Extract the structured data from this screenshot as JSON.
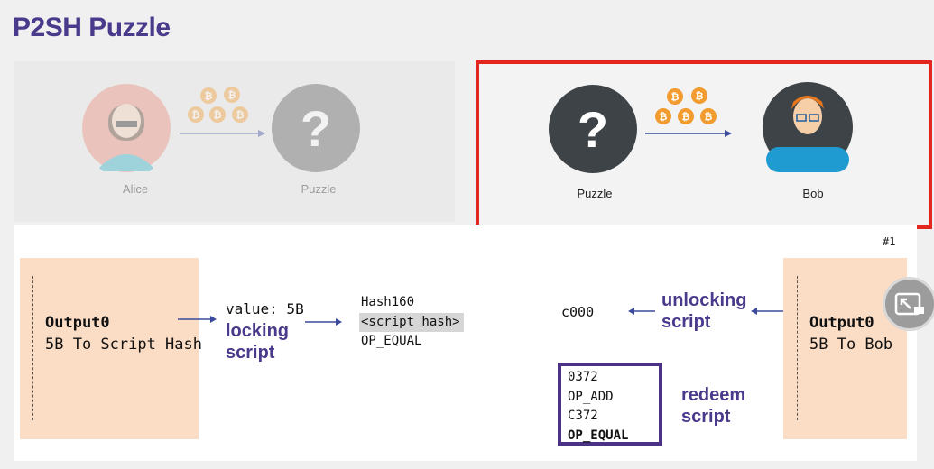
{
  "title": "P2SH Puzzle",
  "top_left": {
    "sender_label": "Alice",
    "receiver_label": "Puzzle"
  },
  "top_right": {
    "sender_label": "Puzzle",
    "receiver_label": "Bob"
  },
  "page_marker": "#1",
  "left_output": {
    "title": "Output0",
    "subtitle": "5B To Script Hash"
  },
  "value_text": "value: 5B",
  "locking_label": [
    "locking",
    "script"
  ],
  "locking_script": [
    "Hash160",
    "<script hash>",
    "OP_EQUAL"
  ],
  "unlocking_value": "c000",
  "unlocking_label": [
    "unlocking",
    "script"
  ],
  "right_output": {
    "title": "Output0",
    "subtitle": "5B To Bob"
  },
  "redeem_script": [
    "0372",
    "OP_ADD",
    "C372",
    "OP_EQUAL"
  ],
  "redeem_label": [
    "redeem",
    "script"
  ],
  "colors": {
    "title": "#4a3a8c",
    "highlight_box": "#e3261f",
    "output_fill": "#fbdcc5",
    "arrow": "#3b4a9c",
    "coin": "#f29b2e"
  },
  "icons": [
    "person-alice-icon",
    "question-mark-icon",
    "bitcoin-coin-icon",
    "person-bob-icon",
    "expand-icon"
  ]
}
